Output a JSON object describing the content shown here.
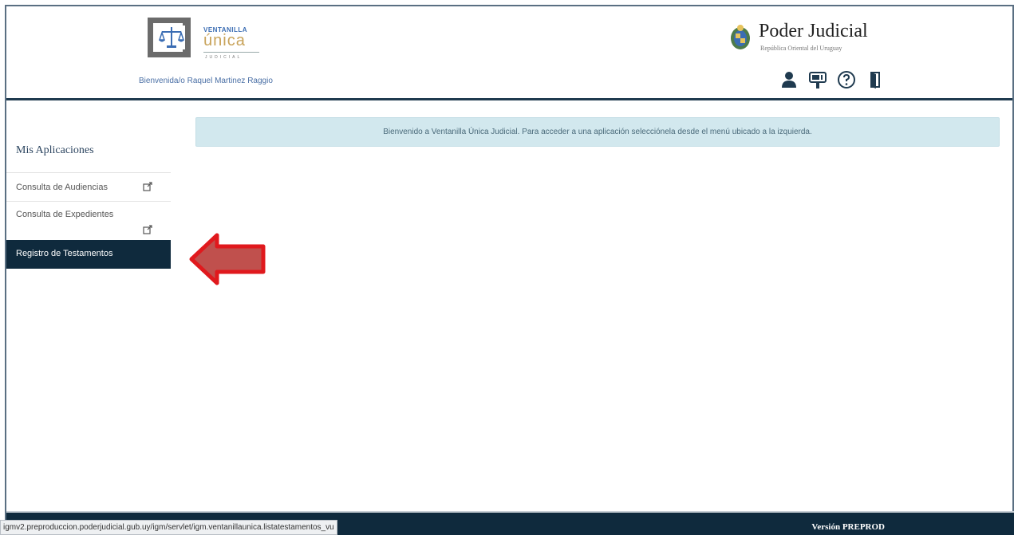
{
  "header": {
    "logo": {
      "line1": "VENTANILLA",
      "line2": "única",
      "line3": "JUDICIAL"
    },
    "welcome_text": "Bienvenida/o Raquel Martinez Raggio",
    "institution_title": "Poder Judicial",
    "institution_subtitle": "República Oriental del Uruguay",
    "icons": [
      "user-icon",
      "mailbox-icon",
      "help-icon",
      "logout-door-icon"
    ]
  },
  "sidebar": {
    "title": "Mis Aplicaciones",
    "items": [
      {
        "label": "Consulta de Audiencias",
        "external": true
      },
      {
        "label": "Consulta de Expedientes",
        "external": true
      },
      {
        "label": "Registro de Testamentos",
        "active": true
      }
    ]
  },
  "main": {
    "alert": "Bienvenido a Ventanilla Única Judicial. Para acceder a una aplicación selecciónela desde el menú ubicado a la izquierda."
  },
  "footer": {
    "version": "Versión PREPROD"
  },
  "status_bar": {
    "url": "igmv2.preproduccion.poderjudicial.gub.uy/igm/servlet/igm.ventanillaunica.listatestamentos_vu"
  },
  "colors": {
    "nav_dark": "#0f2a3d",
    "alert_bg": "#d2e8ee",
    "arrow_red": "#e0191d",
    "logo_gold": "#c8a35a"
  }
}
